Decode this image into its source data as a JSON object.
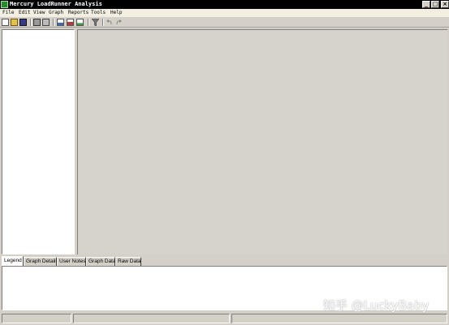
{
  "window": {
    "title": "Mercury LoadRunner Analysis",
    "minimize_glyph": "_",
    "maximize_glyph": "□",
    "close_glyph": "×"
  },
  "menu": {
    "items": [
      {
        "label": "File"
      },
      {
        "label": "Edit"
      },
      {
        "label": "View"
      },
      {
        "label": "Graph"
      },
      {
        "label": "Reports"
      },
      {
        "label": "Tools"
      },
      {
        "label": "Help"
      }
    ]
  },
  "toolbar": {
    "icons": [
      "new-session-icon",
      "open-icon",
      "save-icon",
      "print-icon",
      "print-preview-icon",
      "graph-icon-1",
      "graph-icon-2",
      "graph-icon-3",
      "filter-icon",
      "undo-icon",
      "redo-icon"
    ]
  },
  "tabs": [
    {
      "label": "Legend",
      "active": true
    },
    {
      "label": "Graph Details",
      "active": false
    },
    {
      "label": "User Notes",
      "active": false
    },
    {
      "label": "Graph Data",
      "active": false
    },
    {
      "label": "Raw Data",
      "active": false
    }
  ],
  "status": {
    "panel1": "",
    "panel2": "",
    "panel3": ""
  },
  "watermark": "知乎 @LuckyBaby"
}
